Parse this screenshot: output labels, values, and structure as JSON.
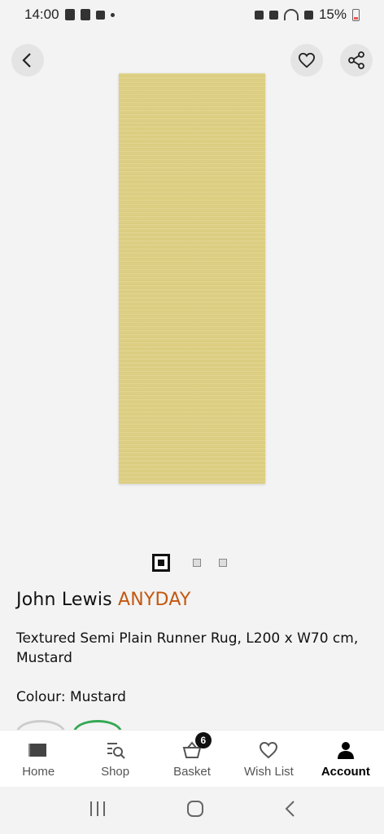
{
  "status_bar": {
    "time": "14:00",
    "battery": "15%"
  },
  "product": {
    "brand_main": "John Lewis",
    "brand_sub": "ANYDAY",
    "title": "Textured Semi Plain Runner Rug, L200 x W70 cm, Mustard",
    "colour_label": "Colour: Mustard",
    "image_count": 3,
    "active_image": 1,
    "rug_color": "#dccd80"
  },
  "bottom_nav": {
    "items": [
      {
        "label": "Home",
        "icon": "home-icon"
      },
      {
        "label": "Shop",
        "icon": "shop-search-icon"
      },
      {
        "label": "Basket",
        "icon": "basket-icon",
        "badge": "6"
      },
      {
        "label": "Wish List",
        "icon": "heart-icon"
      },
      {
        "label": "Account",
        "icon": "account-icon"
      }
    ],
    "active": "Account"
  },
  "colors": {
    "accent": "#c45710",
    "swatch_selected": "#34a853"
  }
}
